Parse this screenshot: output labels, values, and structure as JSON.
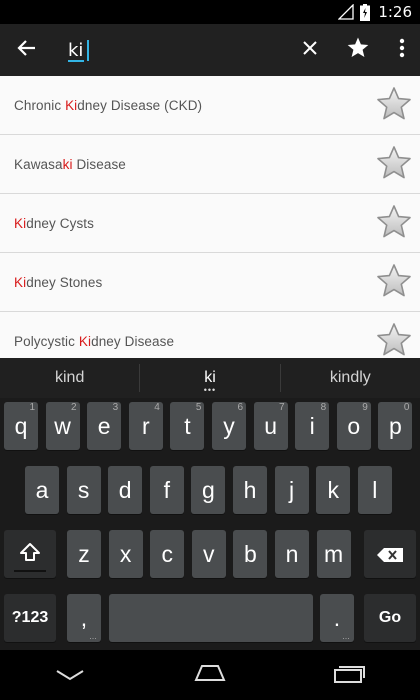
{
  "status_bar": {
    "time": "1:26"
  },
  "search": {
    "query": "ki"
  },
  "results": [
    {
      "before": "Chronic ",
      "match": "Ki",
      "after": "dney Disease (CKD)"
    },
    {
      "before": "Kawasa",
      "match": "ki",
      "after": " Disease"
    },
    {
      "before": "",
      "match": "Ki",
      "after": "dney Cysts"
    },
    {
      "before": "",
      "match": "Ki",
      "after": "dney Stones"
    },
    {
      "before": "Polycystic ",
      "match": "Ki",
      "after": "dney Disease"
    }
  ],
  "keyboard": {
    "suggestions": [
      "kind",
      "ki",
      "kindly"
    ],
    "row1": [
      "q",
      "w",
      "e",
      "r",
      "t",
      "y",
      "u",
      "i",
      "o",
      "p"
    ],
    "row1_hints": [
      "1",
      "2",
      "3",
      "4",
      "5",
      "6",
      "7",
      "8",
      "9",
      "0"
    ],
    "row2": [
      "a",
      "s",
      "d",
      "f",
      "g",
      "h",
      "j",
      "k",
      "l"
    ],
    "row3": [
      "z",
      "x",
      "c",
      "v",
      "b",
      "n",
      "m"
    ],
    "symbols_label": "?123",
    "comma_label": ",",
    "period_label": ".",
    "go_label": "Go"
  },
  "colors": {
    "highlight": "#d81b1b",
    "accent": "#33b5e5",
    "action_bar": "#212121"
  },
  "icons": {
    "back": "arrow-left-icon",
    "clear": "close-icon",
    "favorite": "star-icon",
    "menu": "overflow-menu-icon",
    "shift": "shift-icon",
    "delete": "backspace-icon"
  }
}
